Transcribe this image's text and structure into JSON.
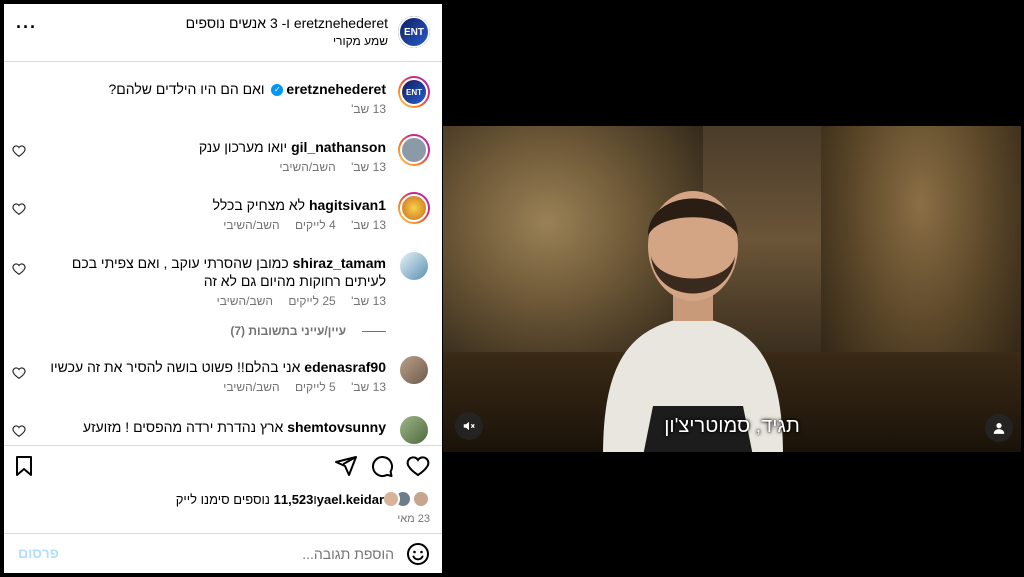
{
  "header": {
    "title": "eretznehederet ו- 3 אנשים נוספים",
    "subtitle": "שמע מקורי",
    "avatar_icon": "eretz-nehederet-logo",
    "more_icon": "more-icon"
  },
  "comments": [
    {
      "user": "eretznehederet",
      "verified": true,
      "text": "ואם הם היו הילדים שלהם?",
      "time": "13 שב'",
      "likes": "",
      "reply": "",
      "heart": false
    },
    {
      "user": "gil_nathanson",
      "verified": false,
      "text": "יואו מערכון ענק",
      "time": "13 שב'",
      "likes": "",
      "reply": "השב/השיבי",
      "heart": true
    },
    {
      "user": "hagitsivan1",
      "verified": false,
      "text": "לא מצחיק בכלל",
      "time": "13 שב'",
      "likes": "4 לייקים",
      "reply": "השב/השיבי",
      "heart": true
    },
    {
      "user": "shiraz_tamam",
      "verified": false,
      "text": "כמובן שהסרתי עוקב , ואם צפיתי בכם לעיתים רחוקות מהיום גם לא זה",
      "time": "13 שב'",
      "likes": "25 לייקים",
      "reply": "השב/השיבי",
      "heart": true
    },
    {
      "user": "edenasraf90",
      "verified": false,
      "text": "אני בהלם!! פשוט בושה להסיר את זה עכשיו",
      "time": "13 שב'",
      "likes": "5 לייקים",
      "reply": "השב/השיבי",
      "heart": true
    },
    {
      "user": "shemtovsunny",
      "verified": false,
      "text": "ארץ נהדרת ירדה מהפסים ! מזועזע",
      "time": "",
      "likes": "",
      "reply": "",
      "heart": true
    }
  ],
  "view_replies": "עיין/עייני בתשובות (7)",
  "likes": {
    "user": "yael.keidar",
    "and": "ו",
    "count": "11,523",
    "suffix": "נוספים סימנו לייק"
  },
  "post_date": "23 מאי",
  "add_comment": {
    "placeholder": "הוספת תגובה...",
    "post_label": "פרסום"
  },
  "video": {
    "subtitle": "תגיד, סמוטריצ'ון",
    "mute_icon": "muted-speaker-icon",
    "user_icon": "user-tag-icon"
  },
  "colors": {
    "accent": "#0095f6",
    "muted": "#737373",
    "post_disabled": "#b2dffc",
    "divider": "#dbdbdb"
  }
}
